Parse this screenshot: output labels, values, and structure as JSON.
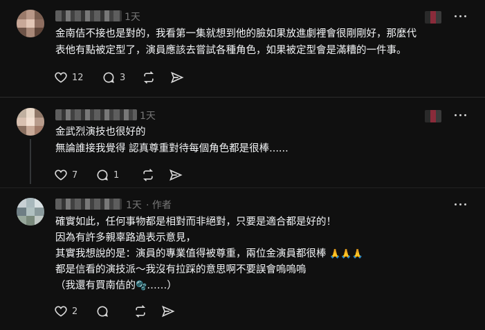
{
  "posts": [
    {
      "time": "1天",
      "author_tag": "",
      "lines": [
        "金南佶不接也是對的，我看第一集就想到他的臉如果放進劇裡會很剛剛好，那麼代",
        "表他有點被定型了，演員應該去嘗試各種角色，如果被定型會是滿糟的一件事。"
      ],
      "like_count": "12",
      "reply_count": "3",
      "icons": [
        "heart-icon",
        "comment-icon",
        "repost-icon",
        "share-icon",
        "more-icon"
      ]
    },
    {
      "time": "1天",
      "author_tag": "",
      "lines": [
        "金武烈演技也很好的",
        "無論誰接我覺得 認真尊重對待每個角色都是很棒......"
      ],
      "like_count": "7",
      "reply_count": "1",
      "icons": [
        "heart-icon",
        "comment-icon",
        "repost-icon",
        "share-icon",
        "more-icon"
      ]
    },
    {
      "time": "1天",
      "author_tag": "· 作者",
      "lines": [
        "確實如此，任何事物都是相對而非絕對，只要是適合都是好的！",
        "因為有許多親辜路過表示意見，",
        "其實我想說的是：演員的專業值得被尊重，兩位金演員都很棒",
        "都是信看的演技派～我沒有拉踩的意思啊不要誤會嗚嗚嗚",
        "（我還有買南佶的",
        "……）"
      ],
      "emoji_pray": "🙏🙏🙏",
      "emoji_bubbles": "🫧",
      "like_count": "2",
      "reply_count": "",
      "icons": [
        "heart-icon",
        "comment-icon",
        "repost-icon",
        "share-icon",
        "more-icon"
      ]
    }
  ]
}
